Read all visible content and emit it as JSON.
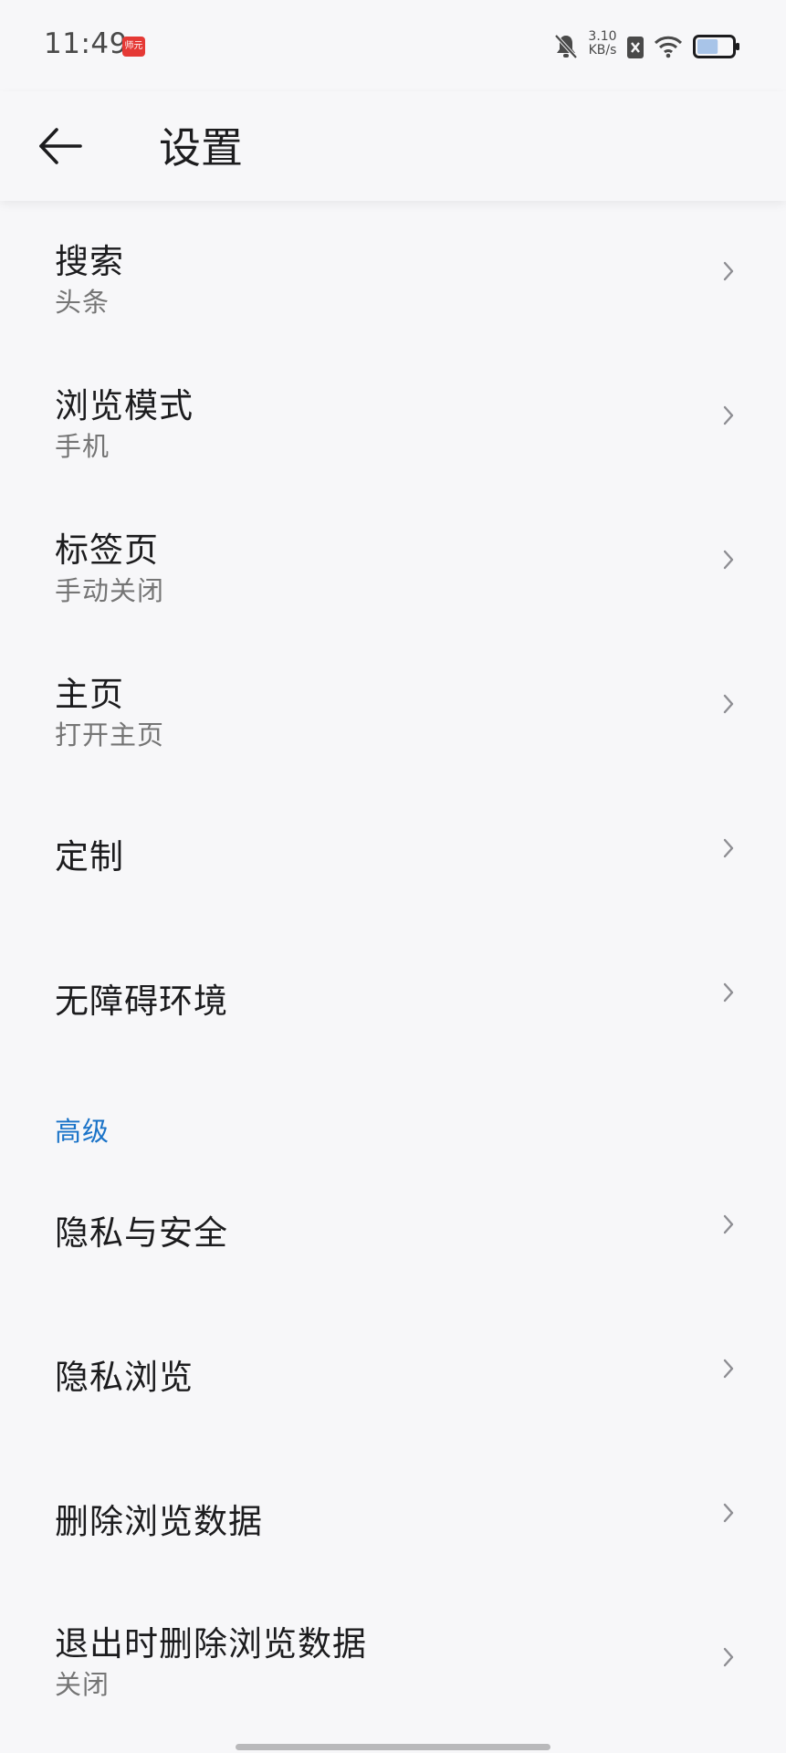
{
  "status_bar": {
    "time": "11:49",
    "app_badge": "师元",
    "net_speed_value": "3.10",
    "net_speed_unit": "KB/s",
    "battery_level": 0.6
  },
  "header": {
    "title": "设置"
  },
  "items": [
    {
      "title": "搜索",
      "subtitle": "头条"
    },
    {
      "title": "浏览模式",
      "subtitle": "手机"
    },
    {
      "title": "标签页",
      "subtitle": "手动关闭"
    },
    {
      "title": "主页",
      "subtitle": "打开主页"
    },
    {
      "title": "定制",
      "subtitle": ""
    },
    {
      "title": "无障碍环境",
      "subtitle": ""
    }
  ],
  "section_advanced": {
    "header": "高级",
    "items": [
      {
        "title": "隐私与安全",
        "subtitle": ""
      },
      {
        "title": "隐私浏览",
        "subtitle": ""
      },
      {
        "title": "删除浏览数据",
        "subtitle": ""
      },
      {
        "title": "退出时删除浏览数据",
        "subtitle": "关闭"
      }
    ]
  },
  "colors": {
    "accent": "#1a73c8",
    "background": "#f7f7f9",
    "battery_fill": "#a8c4e8"
  }
}
